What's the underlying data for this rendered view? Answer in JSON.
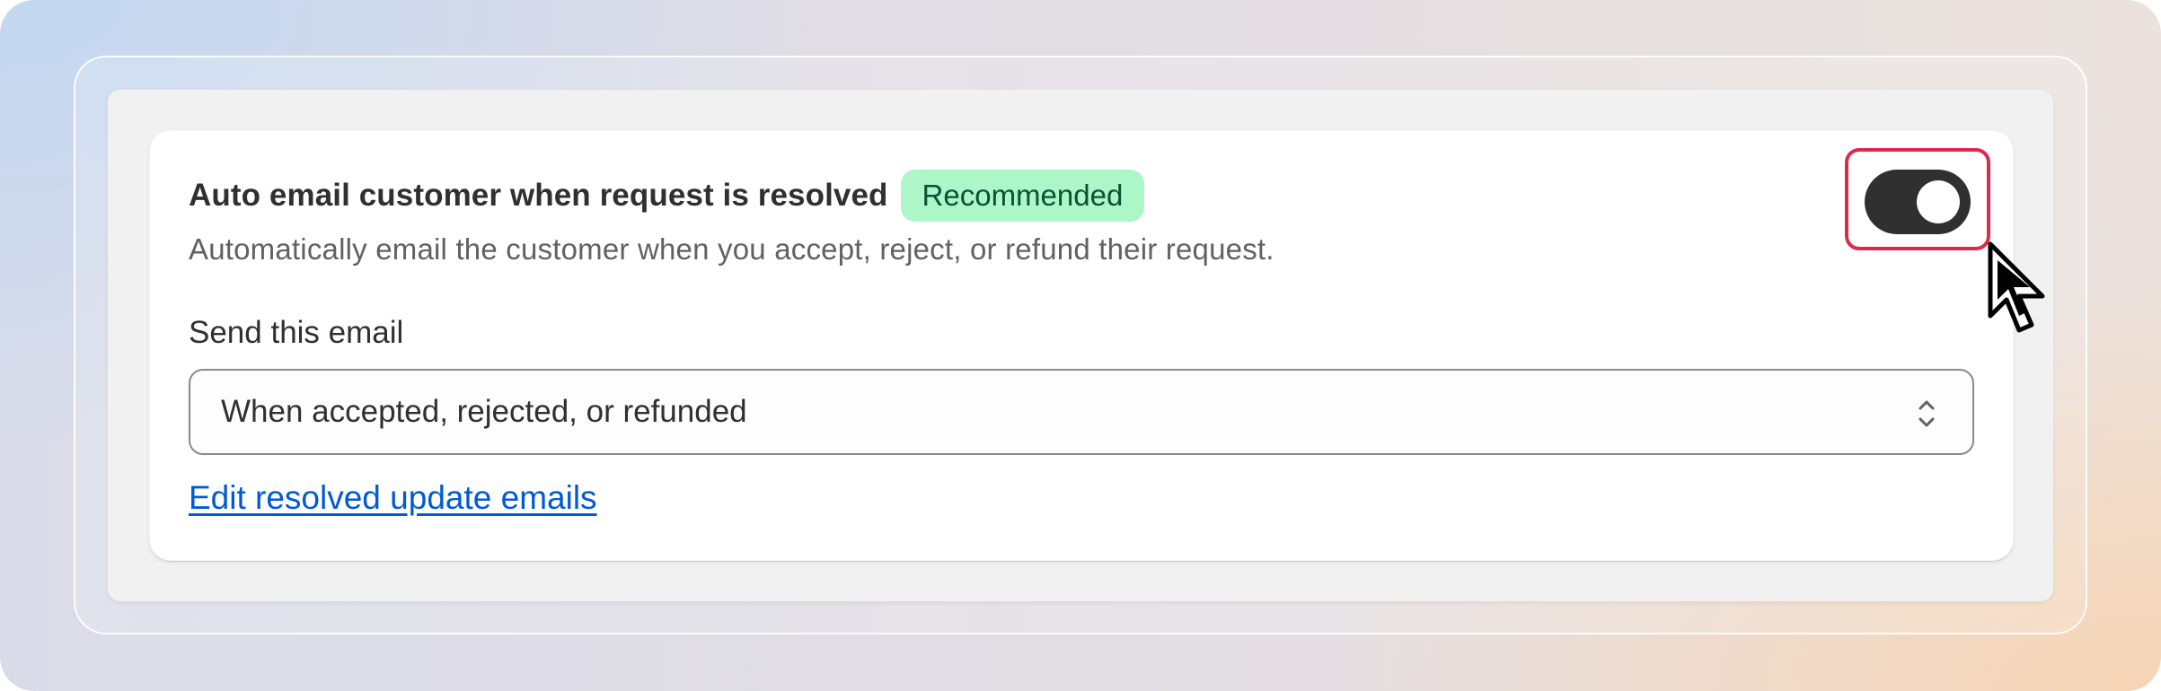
{
  "setting": {
    "title": "Auto email customer when request is resolved",
    "badge": "Recommended",
    "description": "Automatically email the customer when you accept, reject, or refund their request.",
    "toggle_on": true
  },
  "send_email": {
    "label": "Send this email",
    "selected": "When accepted, rejected, or refunded"
  },
  "edit_link": "Edit resolved update emails",
  "colors": {
    "badge_bg": "#acf6c8",
    "badge_text": "#0c5132",
    "toggle_on": "#303030",
    "highlight": "#e0284d",
    "link": "#005bd3"
  },
  "icons": {
    "select": "chevron-up-down-icon",
    "pointer": "mouse-cursor-icon"
  }
}
